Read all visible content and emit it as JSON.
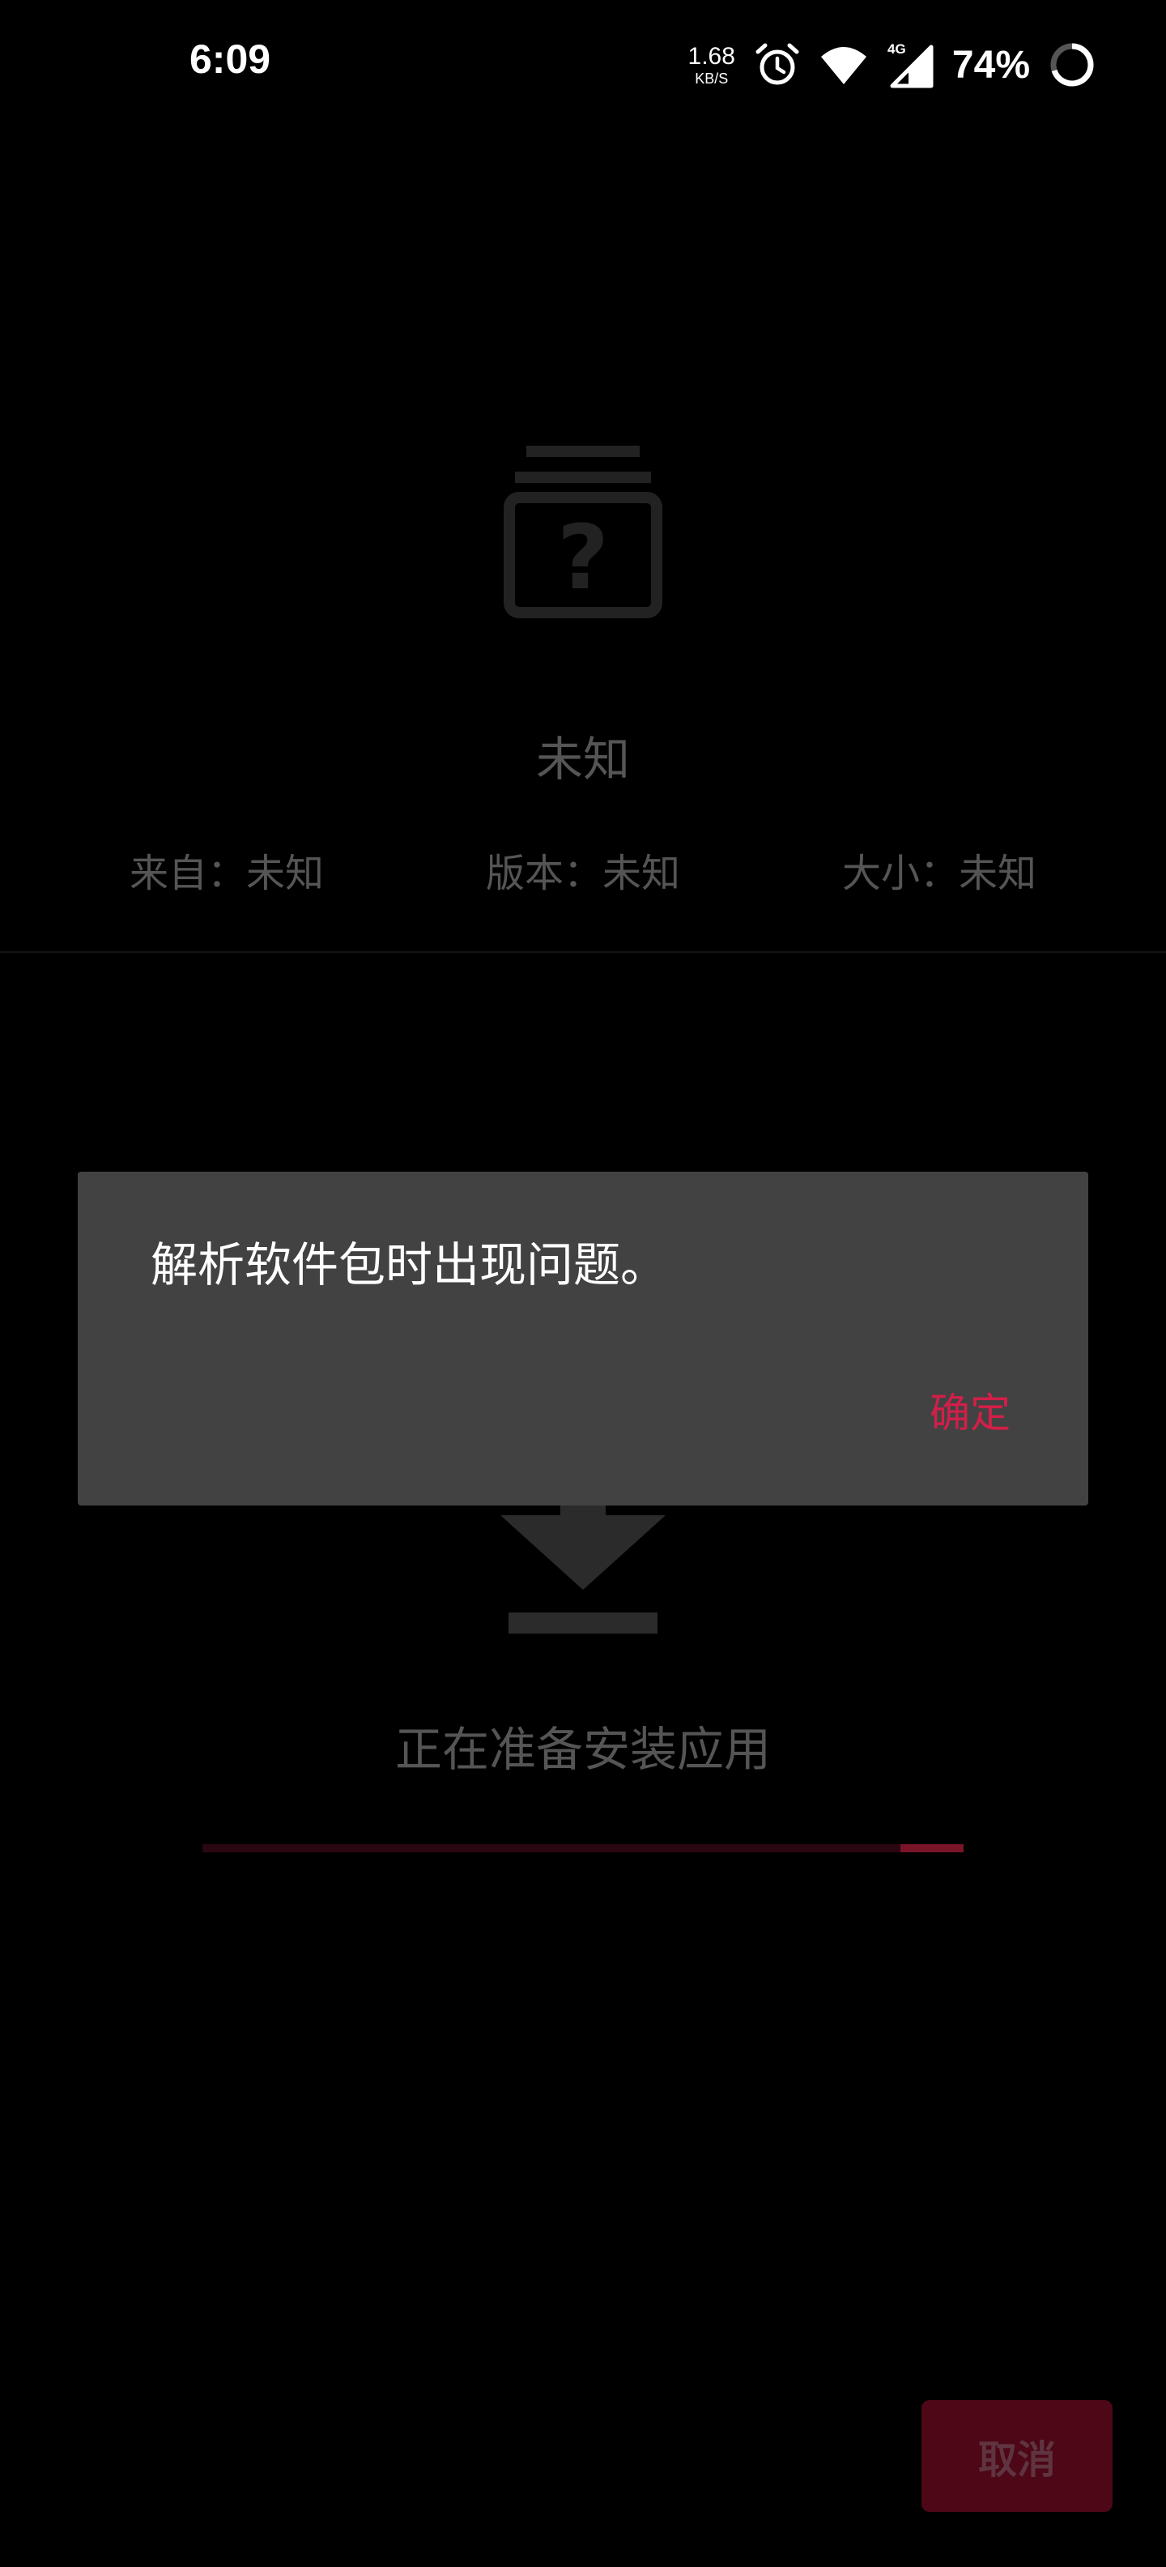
{
  "status_bar": {
    "time": "6:09",
    "net_speed_value": "1.68",
    "net_speed_unit": "KB/S",
    "network_type": "4G",
    "battery_percent": "74%",
    "icons": [
      "alarm-icon",
      "wifi-icon",
      "cellular-signal-icon",
      "battery-icon"
    ]
  },
  "app_info": {
    "name": "未知",
    "from": "来自：未知",
    "version": "版本：未知",
    "size": "大小：未知",
    "icon": "unknown-package-icon"
  },
  "install": {
    "icon": "download-arrow-icon",
    "status": "正在准备安装应用",
    "progress": 0.917
  },
  "dialog": {
    "message": "解析软件包时出现问题。",
    "ok_label": "确定"
  },
  "footer": {
    "cancel_label": "取消"
  },
  "colors": {
    "accent": "#d21f49",
    "dialog_bg": "#424242",
    "background": "#000000",
    "cancel_bg": "#4d0716"
  }
}
